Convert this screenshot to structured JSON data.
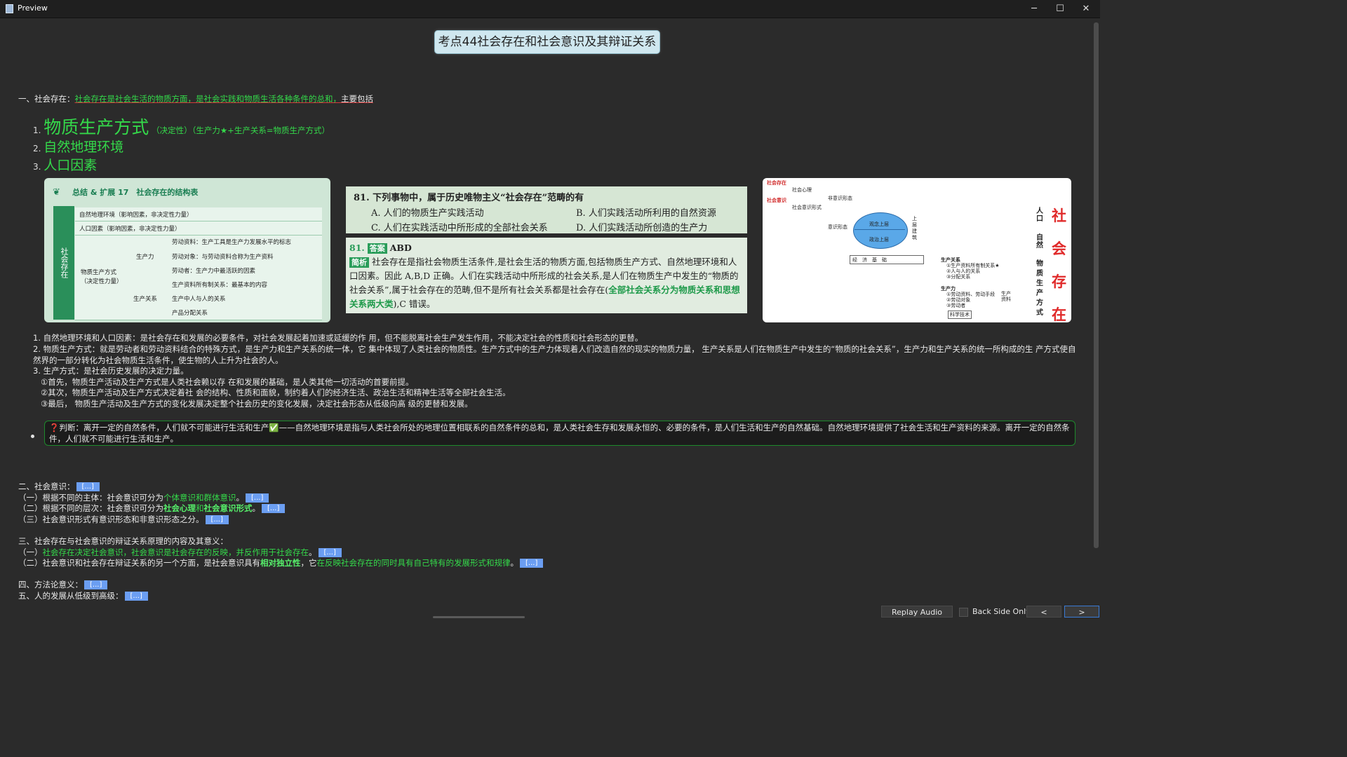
{
  "window": {
    "title": "Preview",
    "minimize": "─",
    "maximize": "☐",
    "close": "✕"
  },
  "heading": "考点44社会存在和社会意识及其辩证关系",
  "section1": {
    "label": "一、社会存在：",
    "definition": "社会存在是社会生活的物质方面，是社会实践和物质生活各种条件的总和，",
    "suffix": "主要包括",
    "items": [
      {
        "num": "1.",
        "text": "物质生产方式",
        "note": "（决定性）（生产力★+生产关系=物质生产方式）"
      },
      {
        "num": "2.",
        "text": "自然地理环境"
      },
      {
        "num": "3.",
        "text": "人口因素"
      }
    ]
  },
  "img1": {
    "title": "总结 & 扩展 17　社会存在的结构表",
    "band": "社会存在",
    "rows": [
      "自然地理环境（影响因素，非决定性力量）",
      "人口因素（影响因素，非决定性力量）"
    ],
    "mode": "物质生产方式（决定性力量）",
    "productivity": "生产力",
    "relations": "生产关系",
    "p_items": [
      "劳动资料：生产工具是生产力发展水平的标志",
      "劳动对象：与劳动资料合称为生产资料",
      "劳动者：生产力中最活跃的因素"
    ],
    "r_items": [
      "生产资料所有制关系：最基本的内容",
      "生产中人与人的关系",
      "产品分配关系"
    ]
  },
  "img2": {
    "question": "81. 下列事物中，属于历史唯物主义“社会存在”范畴的有",
    "options": [
      "A. 人们的物质生产实践活动",
      "B. 人们实践活动所利用的自然资源",
      "C. 人们在实践活动中所形成的全部社会关系",
      "D. 人们实践活动所创造的生产力"
    ]
  },
  "img3": {
    "num": "81.",
    "answer_tag": "答案",
    "answer": "ABD",
    "analysis_tag": "简析",
    "analysis": "社会存在是指社会物质生活条件,是社会生活的物质方面,包括物质生产方式、自然地理环境和人口因素。因此 A,B,D 正确。人们在实践活动中所形成的社会关系,是人们在物质生产中发生的“物质的社会关系”,属于社会存在的范畴,但不是所有社会关系都是社会存在(",
    "analysis_green": "全部社会关系分为物质关系和思想关系两大类",
    "analysis_end": "),C 错误。"
  },
  "img4": {
    "left_labels": [
      "社会存在",
      "社会意识"
    ],
    "labels": [
      "社会心理",
      "社会意识形式",
      "非意识形态",
      "意识形态",
      "观念上层",
      "政治上层",
      "上层建筑",
      "经　济　基　础",
      "生产关系",
      "①生产资料所有制关系★",
      "②人与人的关系",
      "③分配关系",
      "生产力",
      "①劳动资料、劳动手段",
      "②劳动对象",
      "③劳动者",
      "科学技术",
      "生产资料"
    ],
    "vertical": [
      "人口",
      "自然",
      "物质生产方式"
    ],
    "big": [
      "社",
      "会",
      "存",
      "在"
    ]
  },
  "paragraphs": [
    "1. 自然地理环境和人口因素：是社会存在和发展的必要条件，对社会发展起着加速或延缓的作 用，但不能脱离社会生产发生作用，不能决定社会的性质和社会形态的更替。",
    "2. 物质生产方式：就是劳动者和劳动资料结合的特殊方式，是生产力和生产关系的统一体，它 集中体现了人类社会的物质性。生产方式中的生产力体现着人们改造自然的现实的物质力量， 生产关系是人们在物质生产中发生的“物质的社会关系”，生产力和生产关系的统一所构成的生 产方式使自然界的一部分转化为社会物质生活条件，使生物的人上升为社会的人。",
    "3. 生产方式：是社会历史发展的决定力量。",
    "①首先，物质生产活动及生产方式是人类社会赖以存 在和发展的基础，是人类其他一切活动的首要前提。",
    "②其次，物质生产活动及生产方式决定着社 会的结构、性质和面貌，制约着人们的经济生活、政治生活和精神生活等全部社会生活。",
    "③最后， 物质生产活动及生产方式的变化发展决定整个社会历史的变化发展，决定社会形态从低级向高 级的更替和发展。"
  ],
  "judge": {
    "mark": "❓",
    "label": "判断：",
    "text1": "离开一定的自然条件，人们就不可能进行生活和生产",
    "check": "✅",
    "text2": "——自然地理环境是指与人类社会所处的地理位置相联系的自然条件的总和，是人类社会生存和发展永恒的、必要的条件，是人们生活和生产的自然基础。自然地理环境提供了社会生活和生产资料的来源。离开一定的自然条件，人们就不可能进行生活和生产。"
  },
  "cloze": "[...]",
  "section2": {
    "label": "二、社会意识：",
    "l1a": "（一）根据不同的主体：社会意识可分为",
    "l1b": "个体意识和群体意识",
    "l2a": "（二）根据不同的层次：社会意识可分为",
    "l2b": "社会心理",
    "l2c": "和",
    "l2d": "社会意识形式",
    "l3": "（三）社会意识形式有意识形态和非意识形态之分。"
  },
  "section3": {
    "label": "三、社会存在与社会意识的辩证关系原理的内容及其意义：",
    "l1a": "（一）",
    "l1b": "社会存在决定社会意识，社会意识是社会存在的反映，并反作用于社会存在",
    "l2a": "（二）社会意识和社会存在辩证关系的另一个方面，是社会意识具有",
    "l2b": "相对独立性",
    "l2c": "，它",
    "l2d": "在反映社会存在的同时具有自己特有的发展形式和规律"
  },
  "section4": {
    "label": "四、方法论意义："
  },
  "section5": {
    "label": "五、人的发展从低级到高级："
  },
  "footer": {
    "replay": "Replay Audio",
    "back_only": "Back Side Only",
    "prev": "<",
    "next": ">"
  }
}
